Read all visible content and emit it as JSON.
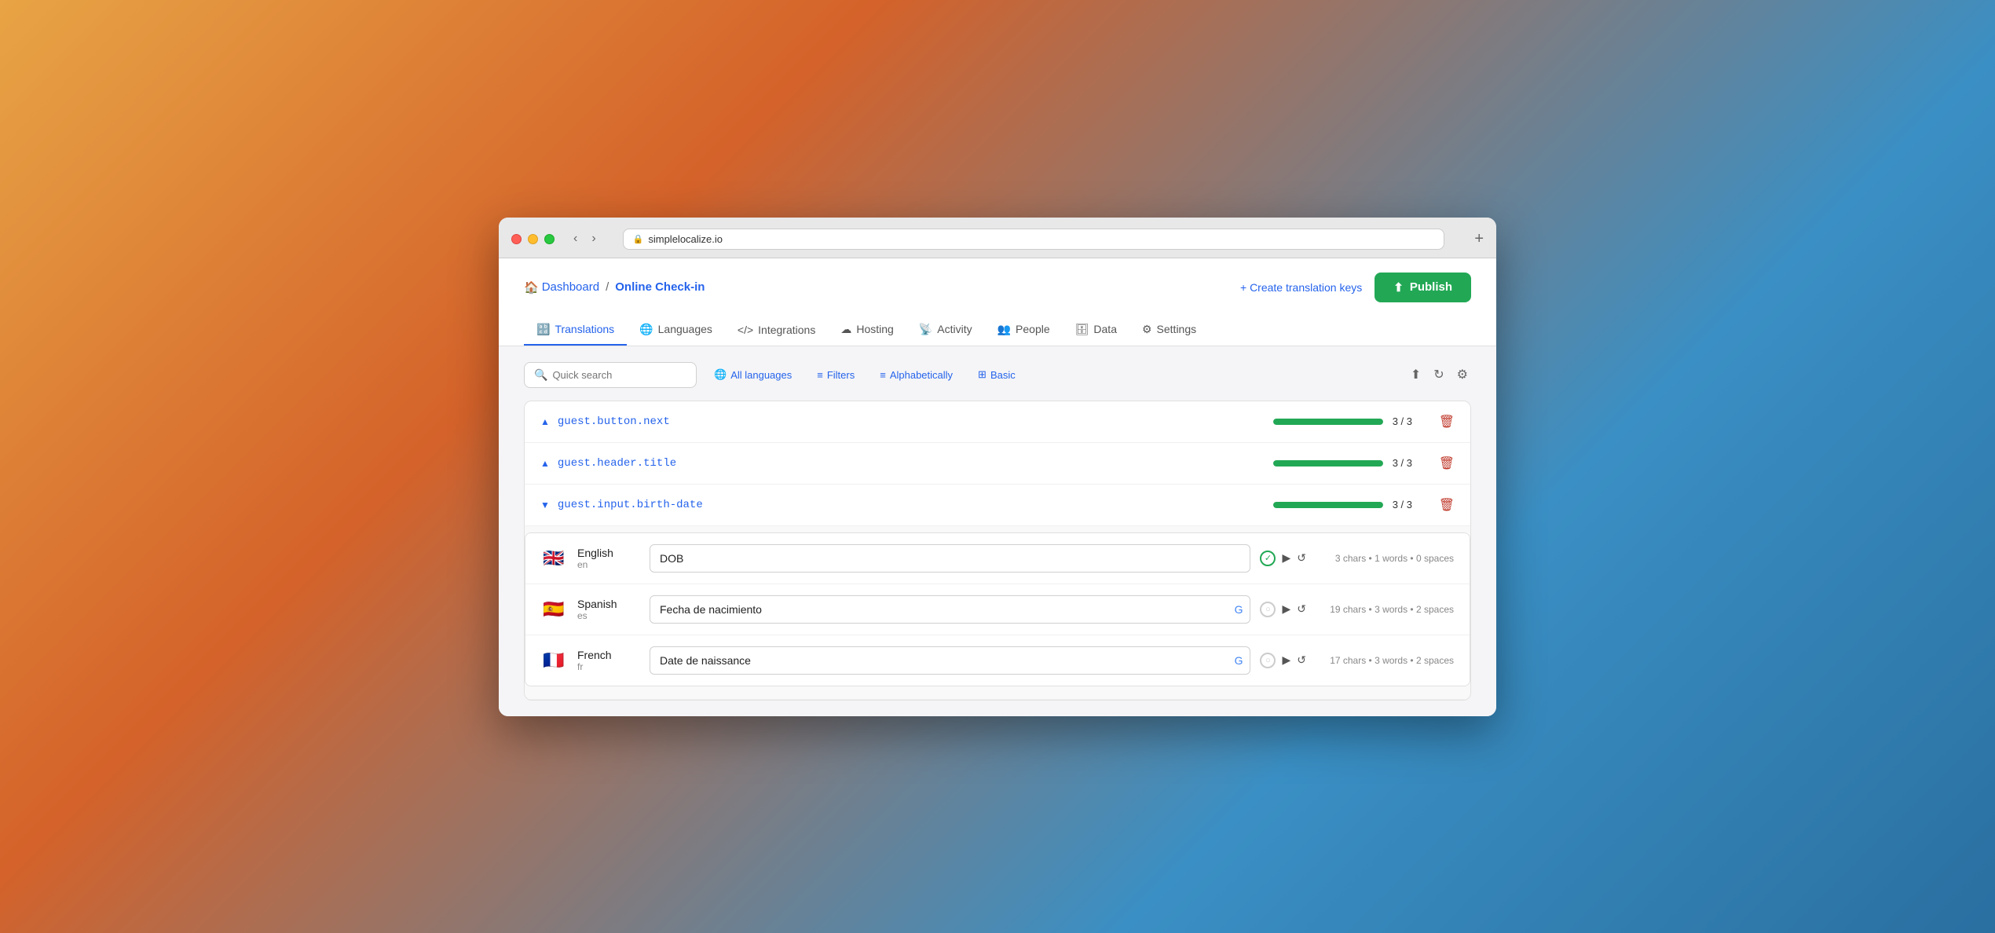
{
  "browser": {
    "url": "simplelocalize.io",
    "new_tab_label": "+"
  },
  "breadcrumb": {
    "home_icon": "🏠",
    "dashboard": "Dashboard",
    "separator": "/",
    "current": "Online Check-in"
  },
  "actions": {
    "create_keys": "+ Create translation keys",
    "publish": "Publish",
    "publish_icon": "⬆"
  },
  "tabs": [
    {
      "id": "translations",
      "label": "Translations",
      "icon": "🔡",
      "active": true
    },
    {
      "id": "languages",
      "label": "Languages",
      "icon": "🌐",
      "active": false
    },
    {
      "id": "integrations",
      "label": "Integrations",
      "icon": "</>",
      "active": false
    },
    {
      "id": "hosting",
      "label": "Hosting",
      "icon": "☁",
      "active": false
    },
    {
      "id": "activity",
      "label": "Activity",
      "icon": "📡",
      "active": false
    },
    {
      "id": "people",
      "label": "People",
      "icon": "👥",
      "active": false
    },
    {
      "id": "data",
      "label": "Data",
      "icon": "🗄",
      "active": false
    },
    {
      "id": "settings",
      "label": "Settings",
      "icon": "⚙",
      "active": false
    }
  ],
  "toolbar": {
    "search_placeholder": "Quick search",
    "all_languages": "All languages",
    "filters": "Filters",
    "alphabetically": "Alphabetically",
    "basic": "Basic"
  },
  "translation_keys": [
    {
      "key": "guest.button.next",
      "expanded": false,
      "progress": 100,
      "progress_label": "3 / 3"
    },
    {
      "key": "guest.header.title",
      "expanded": false,
      "progress": 100,
      "progress_label": "3 / 3"
    },
    {
      "key": "guest.input.birth-date",
      "expanded": true,
      "progress": 100,
      "progress_label": "3 / 3",
      "languages": [
        {
          "name": "English",
          "code": "en",
          "flag": "🇬🇧",
          "value": "DOB",
          "status": "done",
          "has_translate": false,
          "chars_info": "3 chars • 1 words • 0 spaces"
        },
        {
          "name": "Spanish",
          "code": "es",
          "flag": "🇪🇸",
          "value": "Fecha de nacimiento",
          "status": "pending",
          "has_translate": true,
          "chars_info": "19 chars • 3 words • 2 spaces"
        },
        {
          "name": "French",
          "code": "fr",
          "flag": "🇫🇷",
          "value": "Date de naissance",
          "status": "pending",
          "has_translate": true,
          "chars_info": "17 chars • 3 words • 2 spaces"
        }
      ]
    }
  ]
}
